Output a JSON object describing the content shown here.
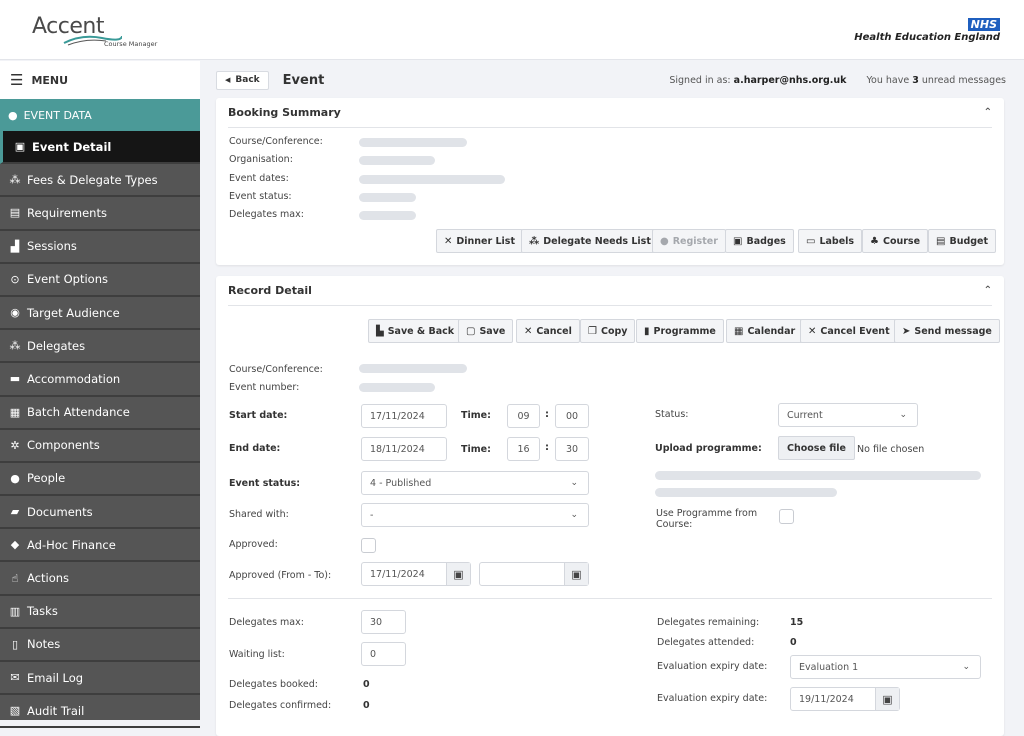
{
  "header": {
    "logo_main": "Accent",
    "logo_sub": "Course Manager",
    "nhs_badge": "NHS",
    "org_name": "Health Education England"
  },
  "sidebar": {
    "menu_label": "MENU",
    "section_label": "EVENT DATA",
    "items": [
      {
        "label": "Event Detail",
        "icon": "calendar-edit-icon",
        "active": true
      },
      {
        "label": "Fees & Delegate Types",
        "icon": "sitemap-icon"
      },
      {
        "label": "Requirements",
        "icon": "clipboard-list-icon"
      },
      {
        "label": "Sessions",
        "icon": "stairs-icon"
      },
      {
        "label": "Event Options",
        "icon": "map-pin-icon"
      },
      {
        "label": "Target Audience",
        "icon": "user-circle-icon"
      },
      {
        "label": "Delegates",
        "icon": "sitemap-icon"
      },
      {
        "label": "Accommodation",
        "icon": "bed-icon"
      },
      {
        "label": "Batch Attendance",
        "icon": "calendar-grid-icon"
      },
      {
        "label": "Components",
        "icon": "cogs-icon"
      },
      {
        "label": "People",
        "icon": "users-icon"
      },
      {
        "label": "Documents",
        "icon": "folder-open-icon"
      },
      {
        "label": "Ad-Hoc Finance",
        "icon": "money-icon"
      },
      {
        "label": "Actions",
        "icon": "hand-pointer-icon"
      },
      {
        "label": "Tasks",
        "icon": "clipboard-check-icon"
      },
      {
        "label": "Notes",
        "icon": "note-icon"
      },
      {
        "label": "Email Log",
        "icon": "envelope-icon"
      },
      {
        "label": "Audit Trail",
        "icon": "audit-icon"
      }
    ]
  },
  "topbar": {
    "back_label": "Back",
    "page_title": "Event",
    "signed_in_prefix": "Signed in as:",
    "signed_in_user": "a.harper@nhs.org.uk",
    "unread_prefix": "You have",
    "unread_count": "3",
    "unread_suffix": "unread messages"
  },
  "booking_summary": {
    "title": "Booking Summary",
    "fields": [
      {
        "label": "Course/Conference:"
      },
      {
        "label": "Organisation:"
      },
      {
        "label": "Event dates:"
      },
      {
        "label": "Event status:"
      },
      {
        "label": "Delegates max:"
      }
    ],
    "buttons": [
      {
        "label": "Dinner List",
        "icon": "utensils-icon"
      },
      {
        "label": "Delegate Needs List",
        "icon": "sitemap-icon"
      },
      {
        "label": "Register",
        "icon": "user-edit-icon",
        "disabled": true
      },
      {
        "label": "Badges",
        "icon": "id-badge-icon"
      },
      {
        "label": "Labels",
        "icon": "label-icon"
      },
      {
        "label": "Course",
        "icon": "course-icon"
      },
      {
        "label": "Budget",
        "icon": "coins-icon"
      }
    ]
  },
  "record_detail": {
    "title": "Record Detail",
    "buttons": [
      {
        "label": "Save & Back",
        "icon": "save-back-icon"
      },
      {
        "label": "Save",
        "icon": "floppy-icon"
      },
      {
        "label": "Cancel",
        "icon": "x-icon"
      },
      {
        "label": "Copy",
        "icon": "copy-icon"
      },
      {
        "label": "Programme",
        "icon": "book-icon"
      },
      {
        "label": "Calendar",
        "icon": "calendar-icon"
      },
      {
        "label": "Cancel Event",
        "icon": "x-icon"
      },
      {
        "label": "Send message",
        "icon": "paper-plane-icon"
      }
    ],
    "course_label": "Course/Conference:",
    "event_number_label": "Event number:",
    "start_date_label": "Start date:",
    "start_date": "17/11/2024",
    "start_time_label": "Time:",
    "start_hour": "09",
    "start_min": "00",
    "end_date_label": "End date:",
    "end_date": "18/11/2024",
    "end_time_label": "Time:",
    "end_hour": "16",
    "end_min": "30",
    "time_sep": ":",
    "event_status_label": "Event status:",
    "event_status": "4 -  Published",
    "shared_with_label": "Shared with:",
    "shared_with": "-",
    "approved_label": "Approved:",
    "approved_checked": false,
    "approved_range_label": "Approved (From - To):",
    "approved_from": "17/11/2024",
    "approved_to": "",
    "status_label": "Status:",
    "status": "Current",
    "upload_label": "Upload programme:",
    "choose_file": "Choose file",
    "no_file": "No file chosen",
    "use_programme_label": "Use Programme from Course:",
    "use_programme_checked": false,
    "delegates_max_label": "Delegates max:",
    "delegates_max": "30",
    "waiting_list_label": "Waiting list:",
    "waiting_list": "0",
    "delegates_booked_label": "Delegates booked:",
    "delegates_booked": "0",
    "delegates_confirmed_label": "Delegates confirmed:",
    "delegates_confirmed": "0",
    "delegates_remaining_label": "Delegates remaining:",
    "delegates_remaining": "15",
    "delegates_attended_label": "Delegates attended:",
    "delegates_attended": "0",
    "evaluation_label": "Evaluation expiry date:",
    "evaluation": "Evaluation 1",
    "evaluation_date_label": "Evaluation expiry date:",
    "evaluation_date": "19/11/2024"
  }
}
